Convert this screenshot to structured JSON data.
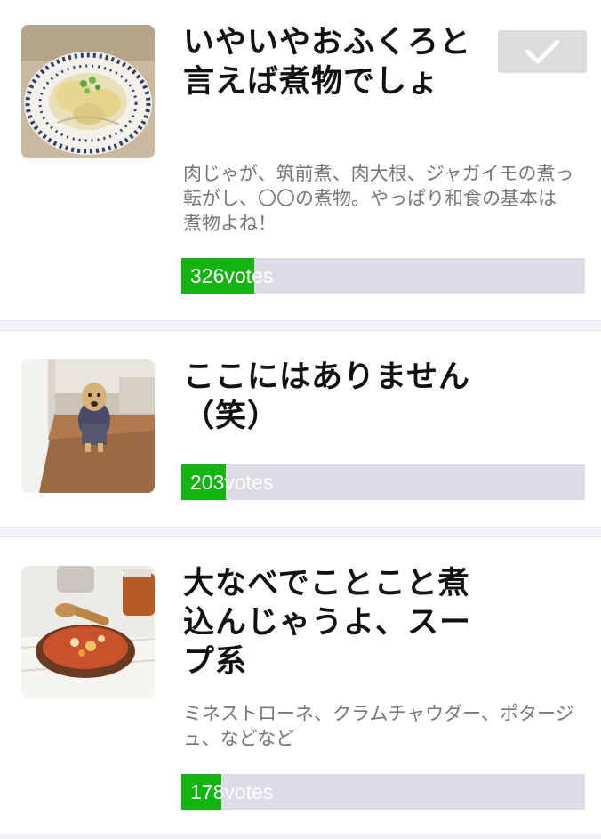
{
  "items": [
    {
      "title": "いやいやおふくろと言えば煮物でしょ",
      "description": "肉じゃが、筑前煮、肉大根、ジャガイモの煮っ転がし、〇〇の煮物。やっぱり和食の基本は煮物よね！",
      "votes": 326,
      "votes_label": "326votes",
      "vote_fraction": 0.18,
      "selected": true,
      "image_icon": "simmered-potato-dish-photo"
    },
    {
      "title": "ここにはありません（笑）",
      "description": "",
      "votes": 203,
      "votes_label": "203votes",
      "vote_fraction": 0.11,
      "selected": false,
      "image_icon": "dog-photo"
    },
    {
      "title": "大なべでことこと煮込んじゃうよ、スープ系",
      "description": "ミネストローネ、クラムチャウダー、ポタージュ、などなど",
      "votes": 178,
      "votes_label": "178votes",
      "vote_fraction": 0.1,
      "selected": false,
      "image_icon": "soup-bowl-photo"
    }
  ],
  "colors": {
    "vote_fill": "#13b312",
    "vote_track": "#dcdce6",
    "check_button": "#dcdcdc"
  }
}
